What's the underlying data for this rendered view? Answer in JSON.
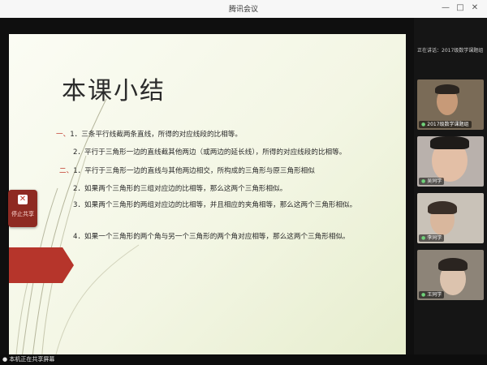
{
  "window": {
    "title": "腾讯会议",
    "minimize_glyph": "—",
    "maximize_glyph": "□",
    "close_glyph": "✕"
  },
  "slide": {
    "title": "本课小结",
    "lines": [
      {
        "marker": "一、",
        "text": "1．三条平行线截两条直线，所得的对应线段的比相等。"
      },
      {
        "marker": "",
        "text": "2．平行于三角形一边的直线截其他两边（或两边的延长线），所得的对应线段的比相等。"
      },
      {
        "marker": "二、",
        "text": "1．平行于三角形一边的直线与其他两边相交，所构成的三角形与原三角形相似"
      },
      {
        "marker": "",
        "text": "2．如果两个三角形的三组对应边的比相等，那么这两个三角形相似。"
      },
      {
        "marker": "",
        "text": "3．如果两个三角形的两组对应边的比相等，并且相应的夹角相等，那么这两个三角形相似。"
      },
      {
        "marker": "",
        "text": "4．如果一个三角形的两个角与另一个三角形的两个角对应相等，那么这两个三角形相似。"
      }
    ]
  },
  "sidebar_button": {
    "label": "停止共享",
    "icon": "close-icon"
  },
  "right_panel": {
    "meeting_info": "正在讲话：2017级数学课题组",
    "participants": [
      {
        "name": "2017级数学课题组",
        "icon": "microphone-icon",
        "skin": "#c79a78",
        "bg": "#7a6b57"
      },
      {
        "name": "吴同学",
        "icon": "microphone-icon",
        "skin": "#e3bfa6",
        "bg": "#b9b1ac"
      },
      {
        "name": "李同学",
        "icon": "microphone-icon",
        "skin": "#d9b79d",
        "bg": "#c9c2b8"
      },
      {
        "name": "王同学",
        "icon": "microphone-icon",
        "skin": "#dcc3ae",
        "bg": "#8d8478"
      }
    ]
  },
  "statusbar": {
    "text": "本机正在共享屏幕"
  },
  "colors": {
    "accent_red": "#b6352b",
    "slide_bg": "#f3f6e4",
    "marker_red": "#c0392b"
  }
}
